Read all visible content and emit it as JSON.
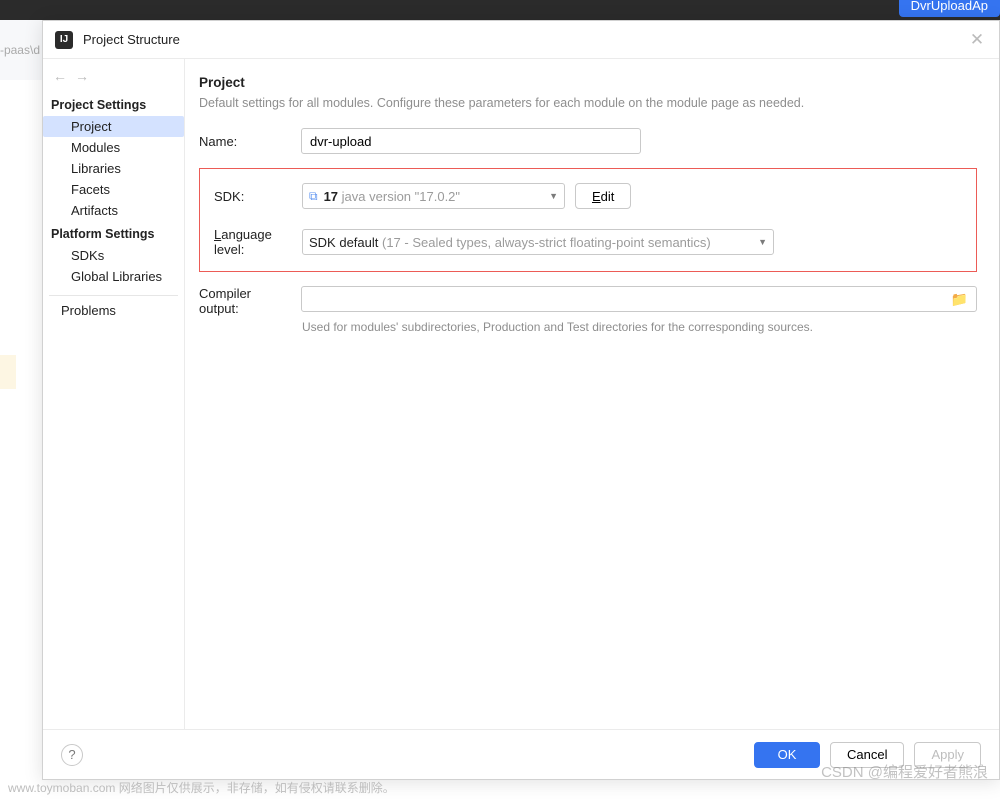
{
  "topbar": {
    "run_config": "DvrUploadAp"
  },
  "side_strip": "r-paas\\d",
  "dialog": {
    "title": "Project Structure",
    "sidebar": {
      "sections": [
        {
          "title": "Project Settings",
          "items": [
            "Project",
            "Modules",
            "Libraries",
            "Facets",
            "Artifacts"
          ],
          "selected": 0
        },
        {
          "title": "Platform Settings",
          "items": [
            "SDKs",
            "Global Libraries"
          ]
        }
      ],
      "problems": "Problems"
    },
    "content": {
      "heading": "Project",
      "description": "Default settings for all modules. Configure these parameters for each module on the module page as needed.",
      "name": {
        "label": "Name:",
        "value": "dvr-upload"
      },
      "sdk": {
        "label": "SDK:",
        "value_strong": "17",
        "value_hint": "java version \"17.0.2\"",
        "edit": "Edit"
      },
      "language_level": {
        "label": "Language level:",
        "value_strong": "SDK default",
        "value_hint": "(17 - Sealed types, always-strict floating-point semantics)"
      },
      "compiler_output": {
        "label": "Compiler output:",
        "value": "",
        "helper": "Used for modules' subdirectories, Production and Test directories for the corresponding sources."
      }
    },
    "footer": {
      "ok": "OK",
      "cancel": "Cancel",
      "apply": "Apply"
    }
  },
  "watermarks": {
    "bottom_left": "www.toymoban.com 网络图片仅供展示，非存储，如有侵权请联系删除。",
    "bottom_right": "CSDN @编程爱好者熊浪"
  }
}
